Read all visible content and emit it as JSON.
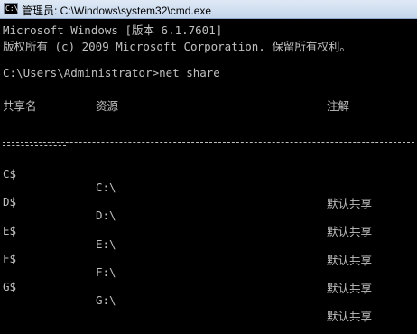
{
  "window": {
    "title": "管理员: C:\\Windows\\system32\\cmd.exe",
    "icon_text": "C:\\"
  },
  "console": {
    "banner_line1": "Microsoft Windows [版本 6.1.7601]",
    "banner_line2": "版权所有 (c) 2009 Microsoft Corporation. 保留所有权利。",
    "prompt": "C:\\Users\\Administrator>net share",
    "headers": {
      "share": "共享名",
      "resource": "资源",
      "remark": "注解"
    },
    "shares": [
      {
        "name": "C$",
        "resource": "C:\\",
        "remark": "默认共享"
      },
      {
        "name": "D$",
        "resource": "D:\\",
        "remark": "默认共享"
      },
      {
        "name": "E$",
        "resource": "E:\\",
        "remark": "默认共享"
      },
      {
        "name": "F$",
        "resource": "F:\\",
        "remark": "默认共享"
      },
      {
        "name": "G$",
        "resource": "G:\\",
        "remark": "默认共享"
      }
    ]
  },
  "colors": {
    "background": "#000000",
    "text": "#c0c0c0",
    "titlebar": "#c4d6ec"
  }
}
